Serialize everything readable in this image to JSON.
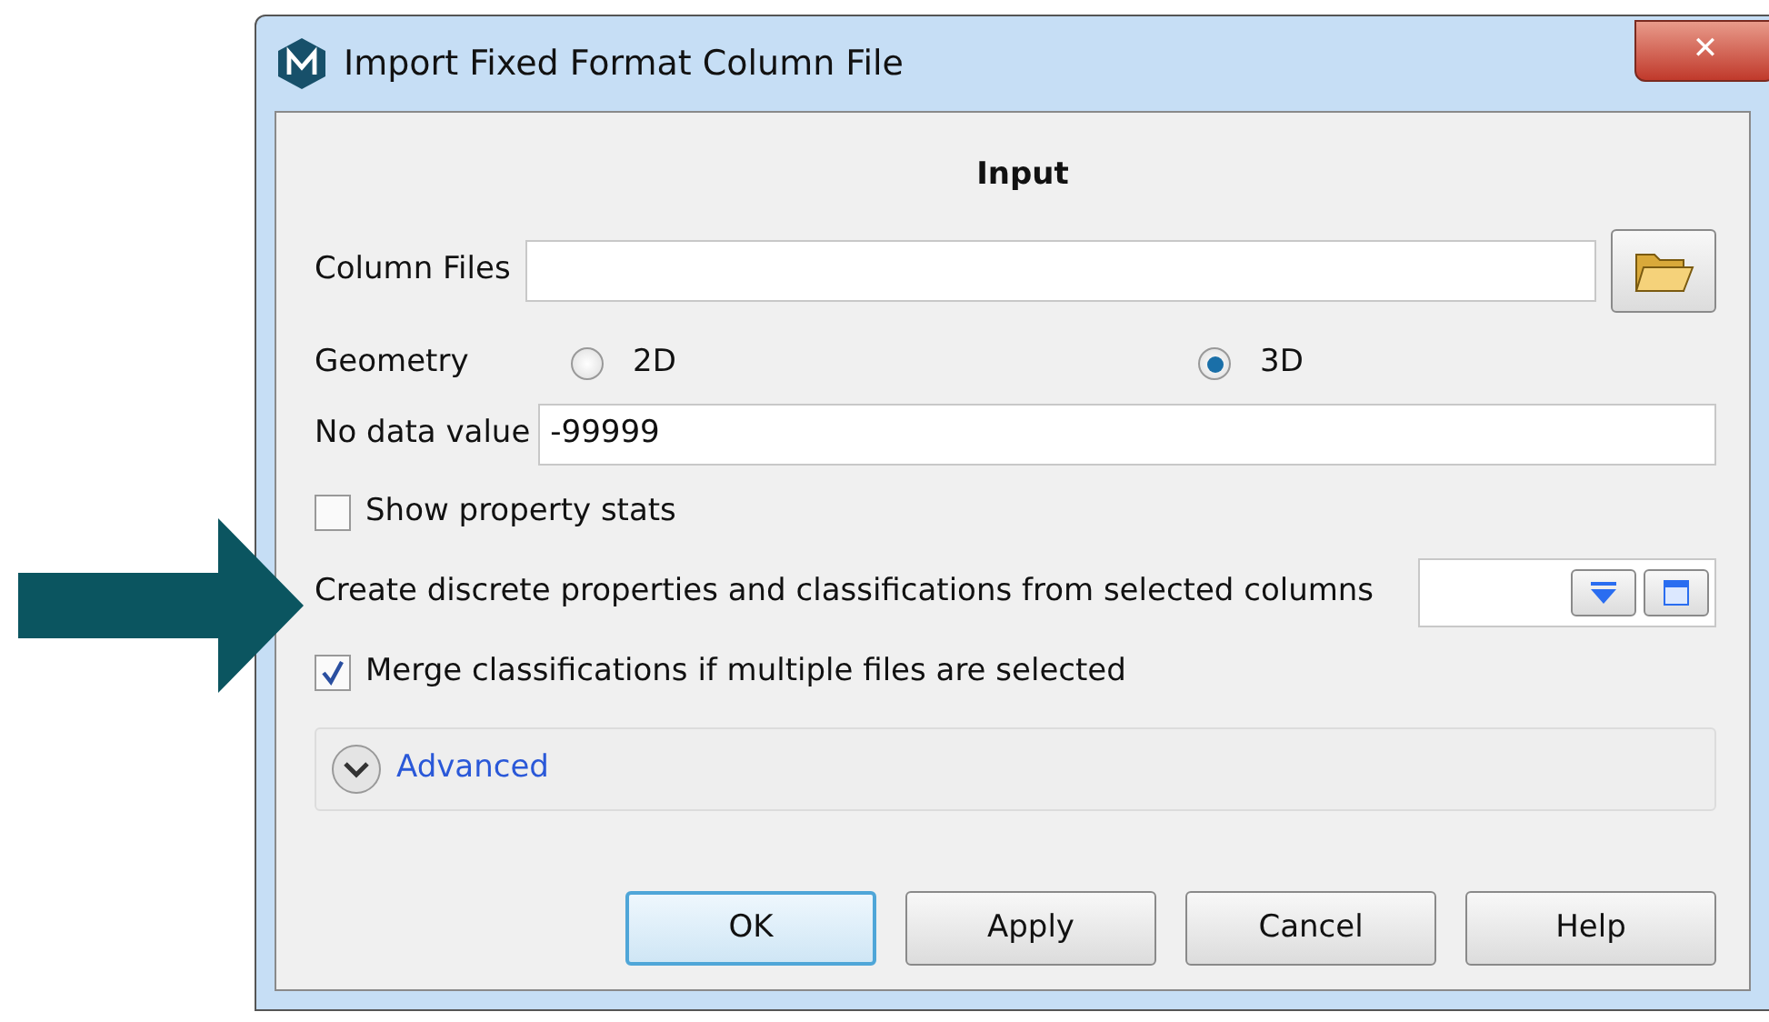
{
  "window": {
    "title": "Import Fixed Format Column File",
    "close": "✕"
  },
  "section_title": "Input",
  "column_files": {
    "label": "Column Files"
  },
  "geometry": {
    "label": "Geometry",
    "options": [
      {
        "label": "2D",
        "selected": false
      },
      {
        "label": "3D",
        "selected": true
      }
    ]
  },
  "no_data": {
    "label": "No data value",
    "value": "-99999"
  },
  "show_stats": {
    "label": "Show property stats",
    "checked": false
  },
  "discrete": {
    "label": "Create discrete properties and classifications from selected columns"
  },
  "merge": {
    "label": "Merge classifications if multiple files are selected",
    "checked": true
  },
  "advanced": {
    "label": "Advanced",
    "expanded": false
  },
  "buttons": [
    {
      "label": "OK",
      "default": true
    },
    {
      "label": "Apply",
      "default": false
    },
    {
      "label": "Cancel",
      "default": false
    },
    {
      "label": "Help",
      "default": false
    }
  ]
}
